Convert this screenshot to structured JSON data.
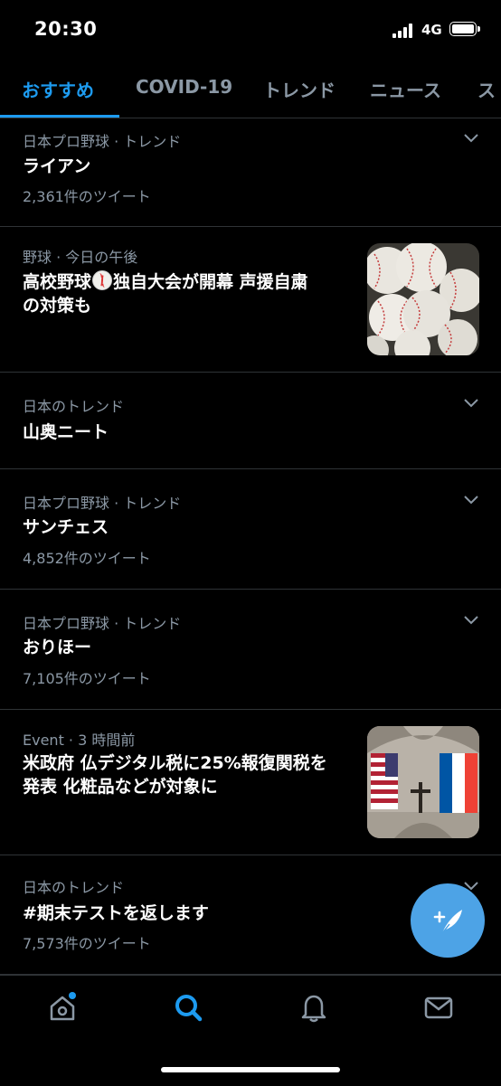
{
  "status_bar": {
    "time": "20:30",
    "network": "4G"
  },
  "tabs": [
    {
      "label": "おすすめ",
      "active": true
    },
    {
      "label": "COVID-19",
      "active": false
    },
    {
      "label": "トレンド",
      "active": false
    },
    {
      "label": "ニュース",
      "active": false
    },
    {
      "label": "ス",
      "active": false
    }
  ],
  "trends": [
    {
      "meta": "日本プロ野球 · トレンド",
      "title": "ライアン",
      "count": "2,361件のツイート"
    },
    {
      "meta": "野球 · 今日の午後",
      "title_part1": "高校野球",
      "title_part2": "独自大会が開幕 声援自粛",
      "title_line2": "の対策も",
      "thumbnail": "baseballs"
    },
    {
      "meta": "日本のトレンド",
      "title": "山奥ニート"
    },
    {
      "meta": "日本プロ野球 · トレンド",
      "title": "サンチェス",
      "count": "4,852件のツイート"
    },
    {
      "meta": "日本プロ野球 · トレンド",
      "title": "おりほー",
      "count": "7,105件のツイート"
    },
    {
      "meta": "Event · 3 時間前",
      "title_line1": "米政府 仏デジタル税に25%報復関税を",
      "title_line2": "発表 化粧品などが対象に",
      "thumbnail": "us-france-flags"
    },
    {
      "meta": "日本のトレンド",
      "title": "#期末テストを返します",
      "count": "7,573件のツイート"
    }
  ],
  "bottom_nav": [
    {
      "icon": "home-icon",
      "badge": true
    },
    {
      "icon": "search-icon",
      "active": true
    },
    {
      "icon": "bell-icon"
    },
    {
      "icon": "mail-icon"
    }
  ],
  "colors": {
    "accent": "#1d9bf0",
    "fab": "#4da3e6",
    "muted": "#8b98a5",
    "divider": "#2f3336"
  }
}
